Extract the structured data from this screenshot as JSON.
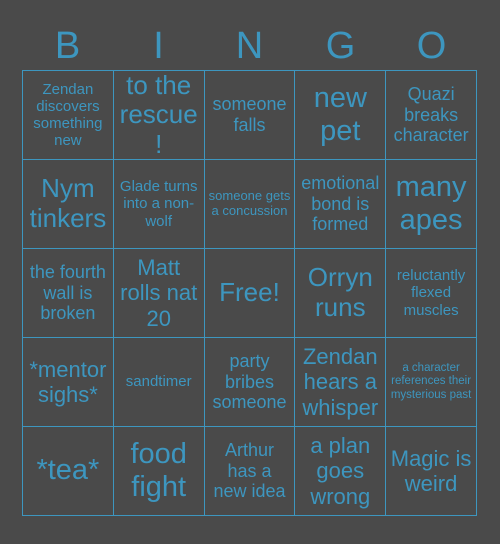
{
  "card": {
    "title_letters": [
      "B",
      "I",
      "N",
      "G",
      "O"
    ],
    "accent_color": "#3d96bf",
    "background_color": "#4a4a4a",
    "columns": 5,
    "rows": 5,
    "squares": [
      {
        "text": "Zendan discovers something new",
        "size": "s-sm",
        "free": false
      },
      {
        "text": "to the rescue!",
        "size": "s-xl",
        "free": false
      },
      {
        "text": "someone falls",
        "size": "s-md",
        "free": false
      },
      {
        "text": "new pet",
        "size": "s-xxl",
        "free": false
      },
      {
        "text": "Quazi breaks character",
        "size": "s-md",
        "free": false
      },
      {
        "text": "Nym tinkers",
        "size": "s-xl",
        "free": false
      },
      {
        "text": "Glade turns into a non-wolf",
        "size": "s-sm",
        "free": false
      },
      {
        "text": "someone gets a concussion",
        "size": "s-xs",
        "free": false
      },
      {
        "text": "emotional bond is formed",
        "size": "s-md",
        "free": false
      },
      {
        "text": "many apes",
        "size": "s-xxl",
        "free": false
      },
      {
        "text": "the fourth wall is broken",
        "size": "s-md",
        "free": false
      },
      {
        "text": "Matt rolls nat 20",
        "size": "s-lg",
        "free": false
      },
      {
        "text": "Free!",
        "size": "s-xl",
        "free": true
      },
      {
        "text": "Orryn runs",
        "size": "s-xl",
        "free": false
      },
      {
        "text": "reluctantly flexed muscles",
        "size": "s-sm",
        "free": false
      },
      {
        "text": "*mentor sighs*",
        "size": "s-lg",
        "free": false
      },
      {
        "text": "sandtimer",
        "size": "s-sm",
        "free": false
      },
      {
        "text": "party bribes someone",
        "size": "s-md",
        "free": false
      },
      {
        "text": "Zendan hears a whisper",
        "size": "s-lg",
        "free": false
      },
      {
        "text": "a character references their mysterious past",
        "size": "s-xxs",
        "free": false
      },
      {
        "text": "*tea*",
        "size": "s-xxl",
        "free": false
      },
      {
        "text": "food fight",
        "size": "s-xxl",
        "free": false
      },
      {
        "text": "Arthur has a new idea",
        "size": "s-md",
        "free": false
      },
      {
        "text": "a plan goes wrong",
        "size": "s-lg",
        "free": false
      },
      {
        "text": "Magic is weird",
        "size": "s-lg",
        "free": false
      }
    ]
  }
}
